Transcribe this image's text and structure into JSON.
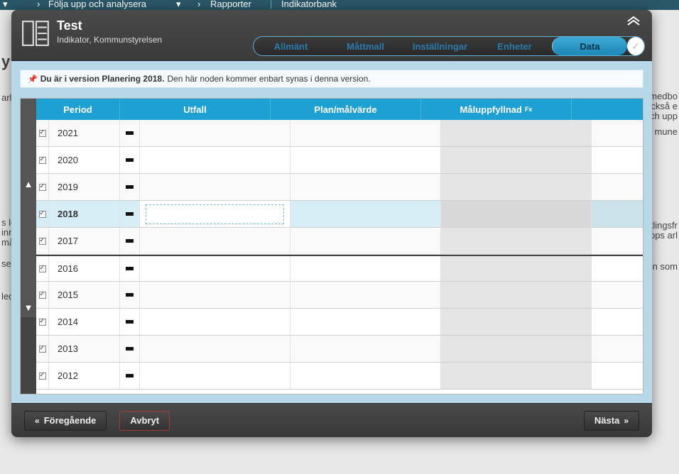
{
  "breadcrumb": {
    "item1": "Följa upp och analysera",
    "item2": "Rapporter",
    "item3": "Indikatorbank"
  },
  "header": {
    "title": "Test",
    "subtitle": "Indikator, Kommunstyrelsen"
  },
  "tabs": {
    "allmant": "Allmänt",
    "mattmall": "Måttmall",
    "installningar": "Inställningar",
    "enheter": "Enheter",
    "data": "Data"
  },
  "version_notice": {
    "bold": "Du är i version Planering 2018.",
    "rest": "Den här noden kommer enbart synas i denna version."
  },
  "columns": {
    "period": "Period",
    "utfall": "Utfall",
    "plan": "Plan/målvärde",
    "mal": "Måluppfyllnad",
    "fx": "Fx"
  },
  "rows": [
    {
      "year": "2021",
      "selected": false,
      "sep": false
    },
    {
      "year": "2020",
      "selected": false,
      "sep": false
    },
    {
      "year": "2019",
      "selected": false,
      "sep": false
    },
    {
      "year": "2018",
      "selected": true,
      "sep": false
    },
    {
      "year": "2017",
      "selected": false,
      "sep": false
    },
    {
      "year": "2016",
      "selected": false,
      "sep": true
    },
    {
      "year": "2015",
      "selected": false,
      "sep": false
    },
    {
      "year": "2014",
      "selected": false,
      "sep": false
    },
    {
      "year": "2013",
      "selected": false,
      "sep": false
    },
    {
      "year": "2012",
      "selected": false,
      "sep": false
    }
  ],
  "footer": {
    "prev": "Föregående",
    "cancel": "Avbryt",
    "next": "Nästa"
  },
  "bg": {
    "t1": "medbo",
    "t2": "också e",
    "t3": "ch upp",
    "t4": "mune",
    "t5": "klingsfr",
    "t6": "pps arl",
    "t7": "n som",
    "t8": "y",
    "t9": "arl",
    "t10": "s le",
    "t11": "inn",
    "t12": "må",
    "t13": "se",
    "t14": "led"
  }
}
